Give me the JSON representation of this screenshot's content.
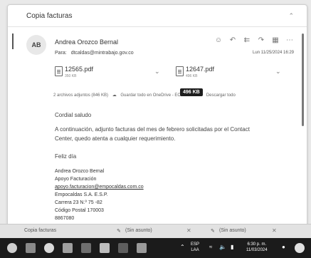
{
  "window": {
    "subject": "Copia facturas"
  },
  "message": {
    "avatar_initials": "AB",
    "sender": "Andrea Orozco Bernal",
    "to_label": "Para:",
    "to_value": "dtcaldas@mintrabajo.gov.co",
    "datetime": "Lun 11/25/2024 16:29"
  },
  "attachments": [
    {
      "name": "12565.pdf",
      "size": "350 KB"
    },
    {
      "name": "12647.pdf",
      "size": "496 KB"
    }
  ],
  "attachment_actions": {
    "summary": "2 archivos adjuntos (846 KB)",
    "save_onedrive": "Guardar todo en OneDrive - ECALDAS",
    "download_all": "Descargar todo"
  },
  "tooltip": "496 KB",
  "body": {
    "greeting": "Cordial saludo",
    "line1": "A continuación, adjunto facturas del mes de febrero solicitadas por el Contact",
    "line2": "Center, quedo atenta a cualquier requerimiento.",
    "closing": "Feliz día"
  },
  "signature": {
    "name": "Andrea Orozco Bernal",
    "role": "Apoyo Facturación",
    "email": "apoyo.facturacion@empocaldas.com.co",
    "company": "Empocaldas S.A. E.S.P.",
    "address": "Carrera 23 N.º 75 -82",
    "postal": "Código Postal 170003",
    "phone": "8867080"
  },
  "tabs": [
    {
      "label": "Copia facturas"
    },
    {
      "label": "(Sin asunto)"
    },
    {
      "label": "(Sin asunto)"
    }
  ],
  "taskbar": {
    "lang_top": "ESP",
    "lang_bottom": "LAA",
    "time": "6:30 p. m.",
    "date": "11/03/2024"
  }
}
